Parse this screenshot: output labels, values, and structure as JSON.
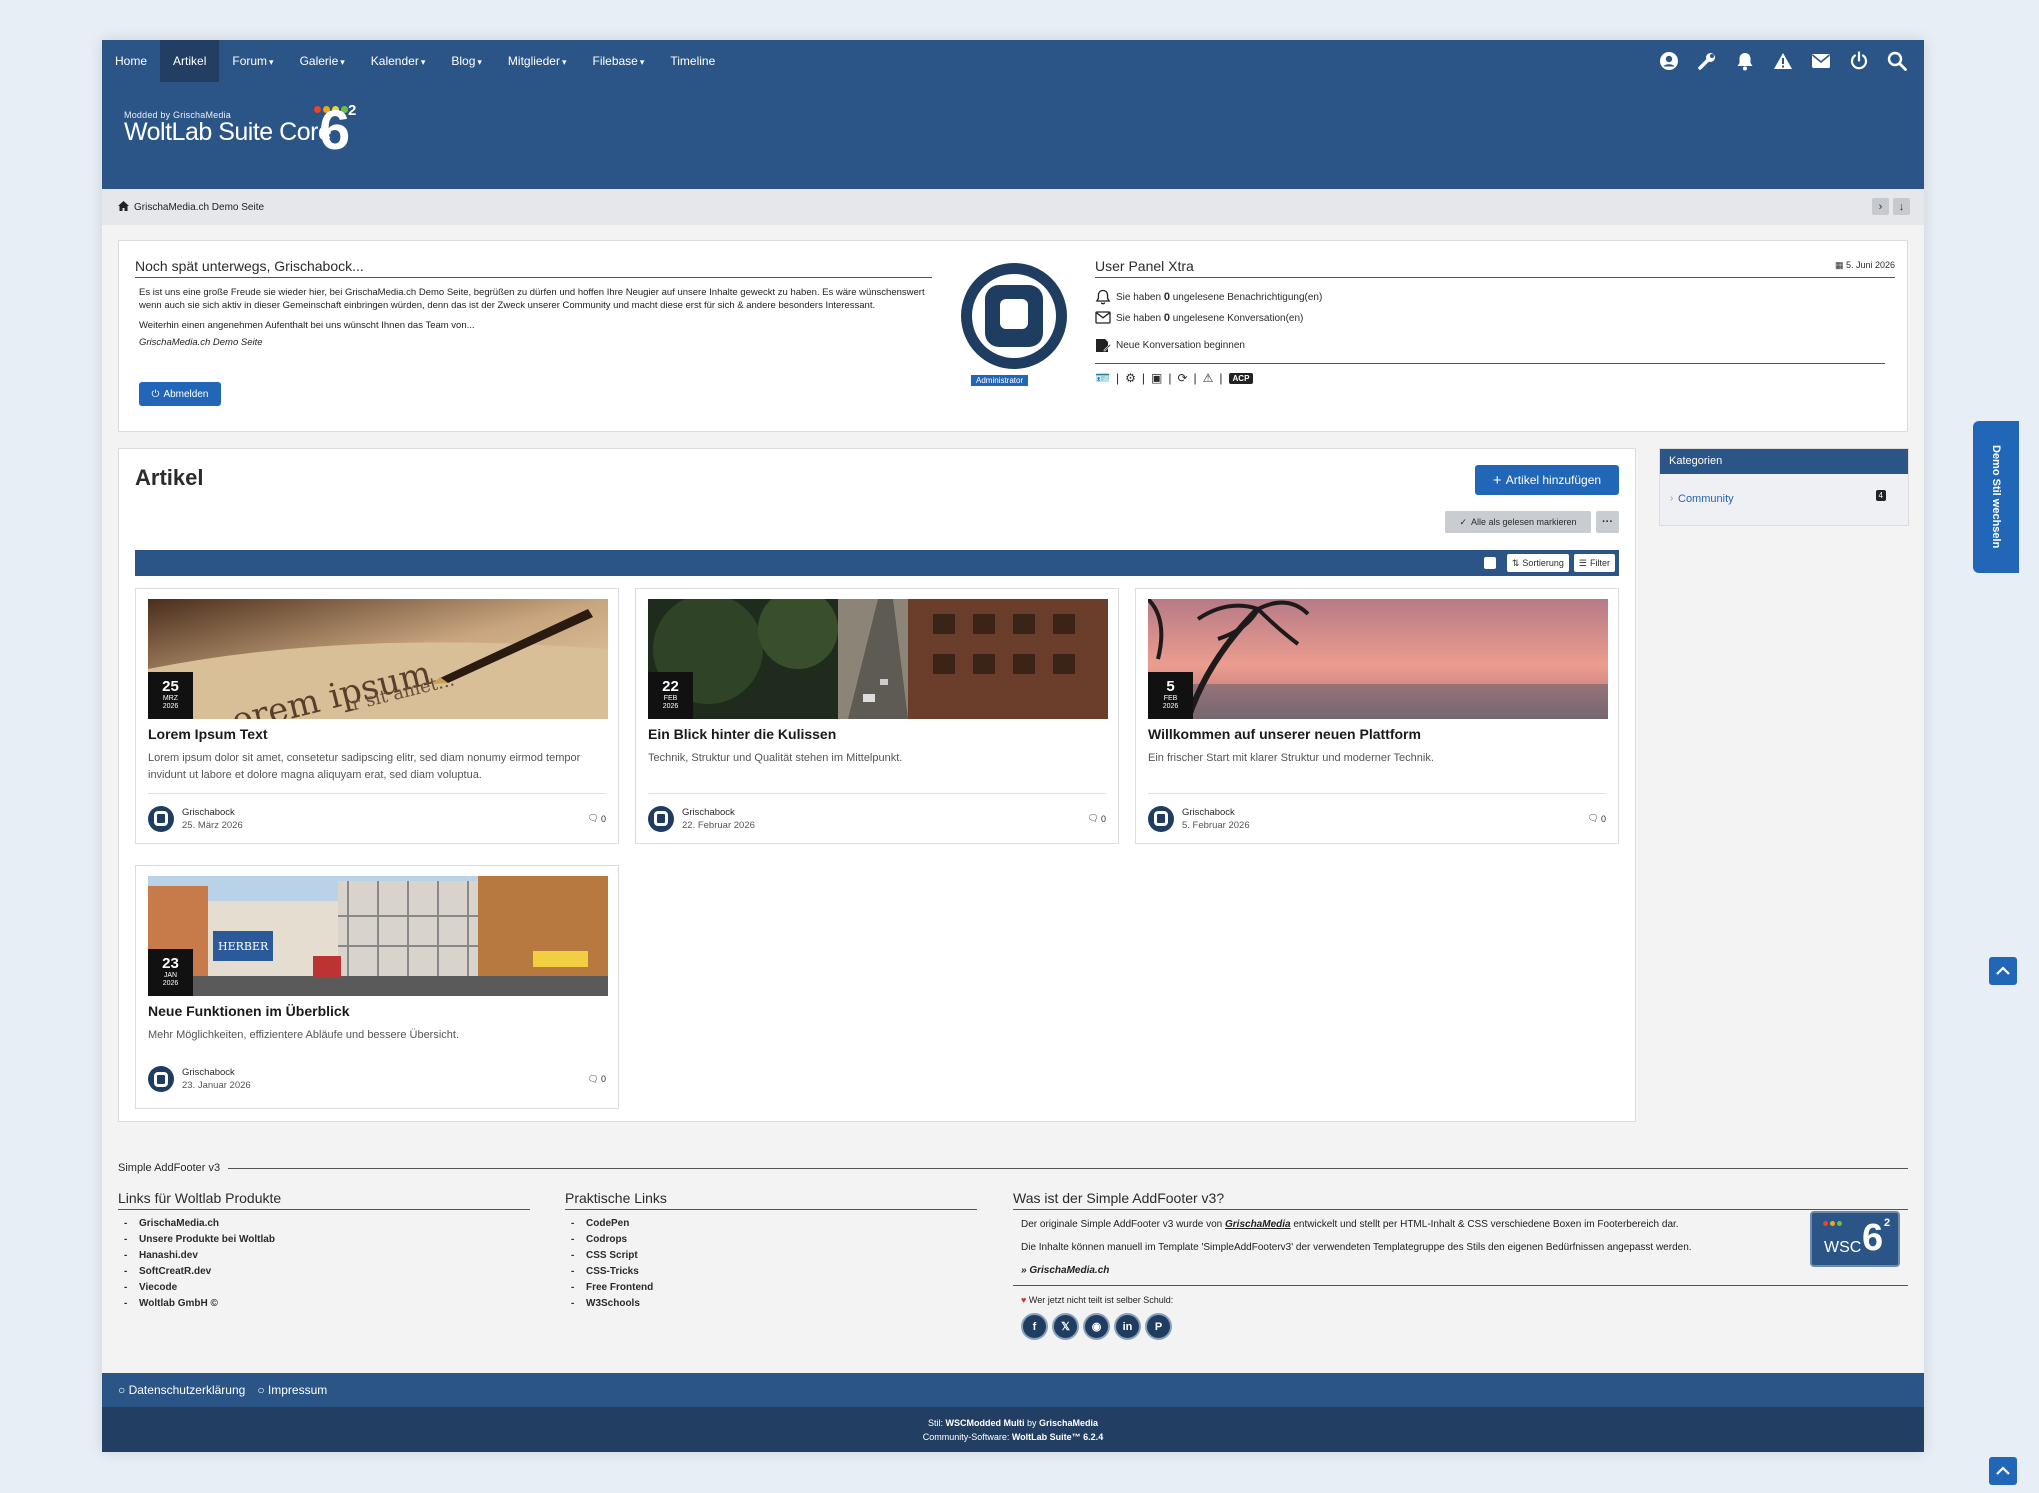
{
  "nav": {
    "items": [
      {
        "label": "Home",
        "dropdown": false
      },
      {
        "label": "Artikel",
        "dropdown": false,
        "active": true
      },
      {
        "label": "Forum",
        "dropdown": true
      },
      {
        "label": "Galerie",
        "dropdown": true
      },
      {
        "label": "Kalender",
        "dropdown": true
      },
      {
        "label": "Blog",
        "dropdown": true
      },
      {
        "label": "Mitglieder",
        "dropdown": true
      },
      {
        "label": "Filebase",
        "dropdown": true
      },
      {
        "label": "Timeline",
        "dropdown": false
      }
    ],
    "icons": [
      "user-icon",
      "wrench-icon",
      "bell-icon",
      "warning-icon",
      "envelope-icon",
      "power-icon",
      "search-icon"
    ]
  },
  "logo": {
    "small": "Modded by GrischaMedia",
    "big": "WoltLab Suite Core",
    "version": "6",
    "sup": "2"
  },
  "breadcrumb": {
    "label": "GrischaMedia.ch Demo Seite"
  },
  "welcome": {
    "title": "Noch spät unterwegs, Grischabock...",
    "text1": "Es ist uns eine große Freude sie wieder hier, bei GrischaMedia.ch Demo Seite, begrüßen zu dürfen und hoffen Ihre Neugier auf unsere Inhalte geweckt zu haben. Es wäre wünschenswert wenn auch sie sich aktiv in dieser Gemeinschaft einbringen würden, denn das ist der Zweck unserer Community und macht diese erst für sich & andere besonders Interessant.",
    "text2": "Weiterhin einen angenehmen Aufenthalt bei uns wünscht Ihnen das Team von...",
    "signature": "GrischaMedia.ch Demo Seite",
    "logout": "Abmelden"
  },
  "user_panel": {
    "title": "User Panel Xtra",
    "date": "5. Juni 2026",
    "role": "Administrator",
    "notif_pre": "Sie haben",
    "notif_count": "0",
    "notif_post": "ungelesene Benachrichtigung(en)",
    "conv_pre": "Sie haben",
    "conv_count": "0",
    "conv_post": "ungelesene Konversation(en)",
    "new_conv": "Neue Konversation beginnen",
    "acp": "ACP"
  },
  "articles": {
    "heading": "Artikel",
    "add_button": "Artikel hinzufügen",
    "mark_read": "Alle als gelesen markieren",
    "sort": "Sortierung",
    "filter": "Filter",
    "items": [
      {
        "day": "25",
        "month": "MRZ",
        "year": "2026",
        "title": "Lorem Ipsum Text",
        "desc": "Lorem ipsum dolor sit amet, consetetur sadipscing elitr, sed diam nonumy eirmod tempor invidunt ut labore et dolore magna aliquyam erat, sed diam voluptua.",
        "author": "Grischabock",
        "date": "25. März 2026",
        "comments": "0"
      },
      {
        "day": "22",
        "month": "FEB",
        "year": "2026",
        "title": "Ein Blick hinter die Kulissen",
        "desc": "Technik, Struktur und Qualität stehen im Mittelpunkt.",
        "author": "Grischabock",
        "date": "22. Februar 2026",
        "comments": "0"
      },
      {
        "day": "5",
        "month": "FEB",
        "year": "2026",
        "title": "Willkommen auf unserer neuen Plattform",
        "desc": "Ein frischer Start mit klarer Struktur und moderner Technik.",
        "author": "Grischabock",
        "date": "5. Februar 2026",
        "comments": "0"
      },
      {
        "day": "23",
        "month": "JAN",
        "year": "2026",
        "title": "Neue Funktionen im Überblick",
        "desc": "Mehr Möglichkeiten, effizientere Abläufe und bessere Übersicht.",
        "author": "Grischabock",
        "date": "23. Januar 2026",
        "comments": "0"
      }
    ]
  },
  "sidebar": {
    "title": "Kategorien",
    "item": "Community",
    "count": "4"
  },
  "style_tab": "Demo Stil wechseln",
  "footer_box": {
    "title": "Simple AddFooter v3",
    "col1": {
      "title": "Links für Woltlab Produkte",
      "links": [
        "GrischaMedia.ch",
        "Unsere Produkte bei Woltlab",
        "Hanashi.dev",
        "SoftCreatR.dev",
        "Viecode",
        "Woltlab GmbH ©"
      ]
    },
    "col2": {
      "title": "Praktische Links",
      "links": [
        "CodePen",
        "Codrops",
        "CSS Script",
        "CSS-Tricks",
        "Free Frontend",
        "W3Schools"
      ]
    },
    "col3": {
      "title": "Was ist der Simple AddFooter v3?",
      "p1_pre": "Der originale Simple AddFooter v3 wurde von",
      "p1_brand": "GrischaMedia",
      "p1_post": "entwickelt und stellt per HTML-Inhalt & CSS verschiedene Boxen im Footerbereich dar.",
      "p2": "Die Inhalte können manuell im Template 'SimpleAddFooterv3' der verwendeten Templategruppe des Stils den eigenen Bedürfnissen angepasst werden.",
      "link": "» GrischaMedia.ch",
      "share": "Wer jetzt nicht teilt ist selber Schuld:",
      "logo_text": "WSC",
      "logo_num": "6",
      "logo_sup": "2"
    }
  },
  "footer": {
    "privacy": "Datenschutzerklärung",
    "imprint": "Impressum",
    "style_label": "Stil:",
    "style_name": "WSCModded Multi",
    "style_by": "by",
    "style_author": "GrischaMedia",
    "software_label": "Community-Software:",
    "software": "WoltLab Suite™ 6.2.4"
  },
  "colors": {
    "primary": "#2b5586",
    "dark": "#223f63",
    "accent": "#2266b8"
  }
}
